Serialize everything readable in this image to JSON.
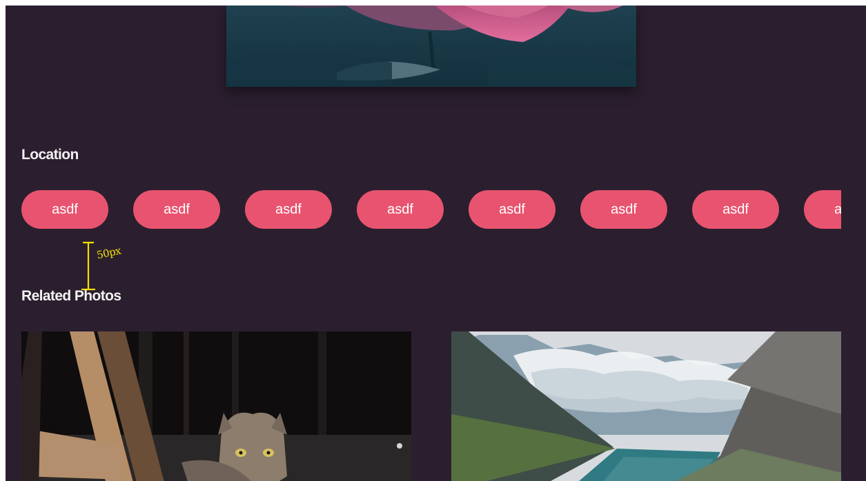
{
  "page": {
    "background_color": "#2b1f2f",
    "accent_color": "#e8546f"
  },
  "hero": {
    "subject": "pink lotus flower image"
  },
  "location": {
    "title": "Location",
    "tags": [
      "asdf",
      "asdf",
      "asdf",
      "asdf",
      "asdf",
      "asdf",
      "asdf",
      "asdf"
    ]
  },
  "annotation": {
    "text": "50px",
    "color": "#f5e000"
  },
  "related": {
    "title": "Related Photos",
    "photos": [
      {
        "subject": "tabby cat beside wooden ladder"
      },
      {
        "subject": "mountain lake with clouds"
      }
    ]
  }
}
